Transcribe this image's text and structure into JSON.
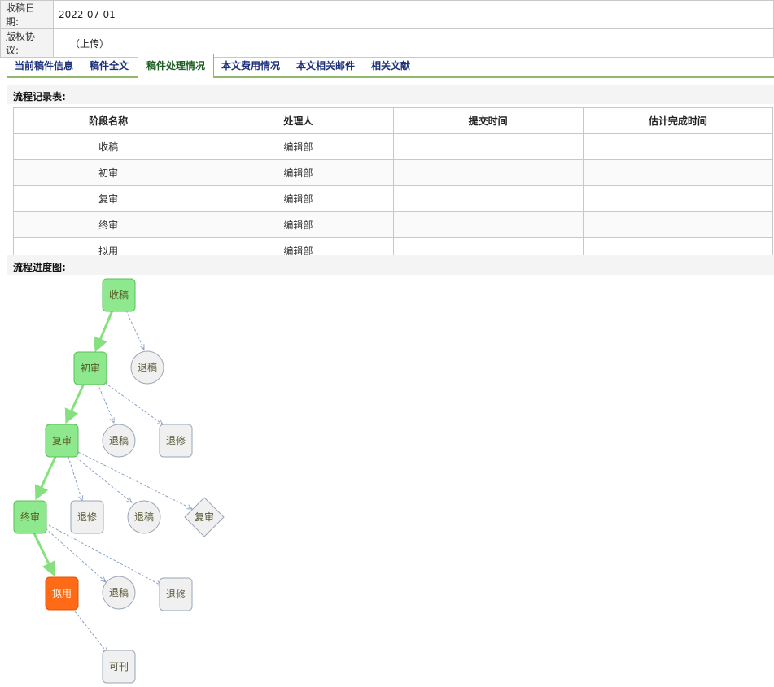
{
  "info": {
    "rows": [
      {
        "label": "收稿日期:",
        "value": "2022-07-01"
      },
      {
        "label": "版权协议:",
        "value": "（上传）"
      }
    ]
  },
  "tabs": [
    {
      "label": "当前稿件信息"
    },
    {
      "label": "稿件全文"
    },
    {
      "label": "稿件处理情况",
      "active": true
    },
    {
      "label": "本文费用情况"
    },
    {
      "label": "本文相关邮件"
    },
    {
      "label": "相关文献"
    }
  ],
  "records": {
    "title": "流程记录表:",
    "headers": [
      "阶段名称",
      "处理人",
      "提交时间",
      "估计完成时间"
    ],
    "rows": [
      [
        "收稿",
        "编辑部",
        "",
        ""
      ],
      [
        "初审",
        "编辑部",
        "",
        ""
      ],
      [
        "复审",
        "编辑部",
        "",
        ""
      ],
      [
        "终审",
        "编辑部",
        "",
        ""
      ],
      [
        "拟用",
        "编辑部",
        "",
        ""
      ]
    ]
  },
  "flow": {
    "title": "流程进度图:",
    "colors": {
      "done": "#8ee88e",
      "current": "#ff6a16",
      "pending": "#f0f0f0",
      "edge_done": "#86e07f",
      "edge_pending": "#8aa0c8"
    },
    "nodes": [
      {
        "id": "n1",
        "label": "收稿",
        "shape": "rect",
        "state": "done"
      },
      {
        "id": "n2",
        "label": "退稿",
        "shape": "circle",
        "state": "pending"
      },
      {
        "id": "n3",
        "label": "初审",
        "shape": "rect",
        "state": "done"
      },
      {
        "id": "n4",
        "label": "退稿",
        "shape": "circle",
        "state": "pending"
      },
      {
        "id": "n5",
        "label": "退修",
        "shape": "rect",
        "state": "pending"
      },
      {
        "id": "n6",
        "label": "复审",
        "shape": "rect",
        "state": "done"
      },
      {
        "id": "n7",
        "label": "退修",
        "shape": "rect",
        "state": "pending"
      },
      {
        "id": "n8",
        "label": "退稿",
        "shape": "circle",
        "state": "pending"
      },
      {
        "id": "n9",
        "label": "复审",
        "shape": "diamond",
        "state": "pending"
      },
      {
        "id": "n10",
        "label": "终审",
        "shape": "rect",
        "state": "done"
      },
      {
        "id": "n11",
        "label": "拟用",
        "shape": "rect",
        "state": "current"
      },
      {
        "id": "n12",
        "label": "退稿",
        "shape": "circle",
        "state": "pending"
      },
      {
        "id": "n13",
        "label": "退修",
        "shape": "rect",
        "state": "pending"
      },
      {
        "id": "n14",
        "label": "可刊",
        "shape": "rect",
        "state": "pending"
      }
    ]
  }
}
